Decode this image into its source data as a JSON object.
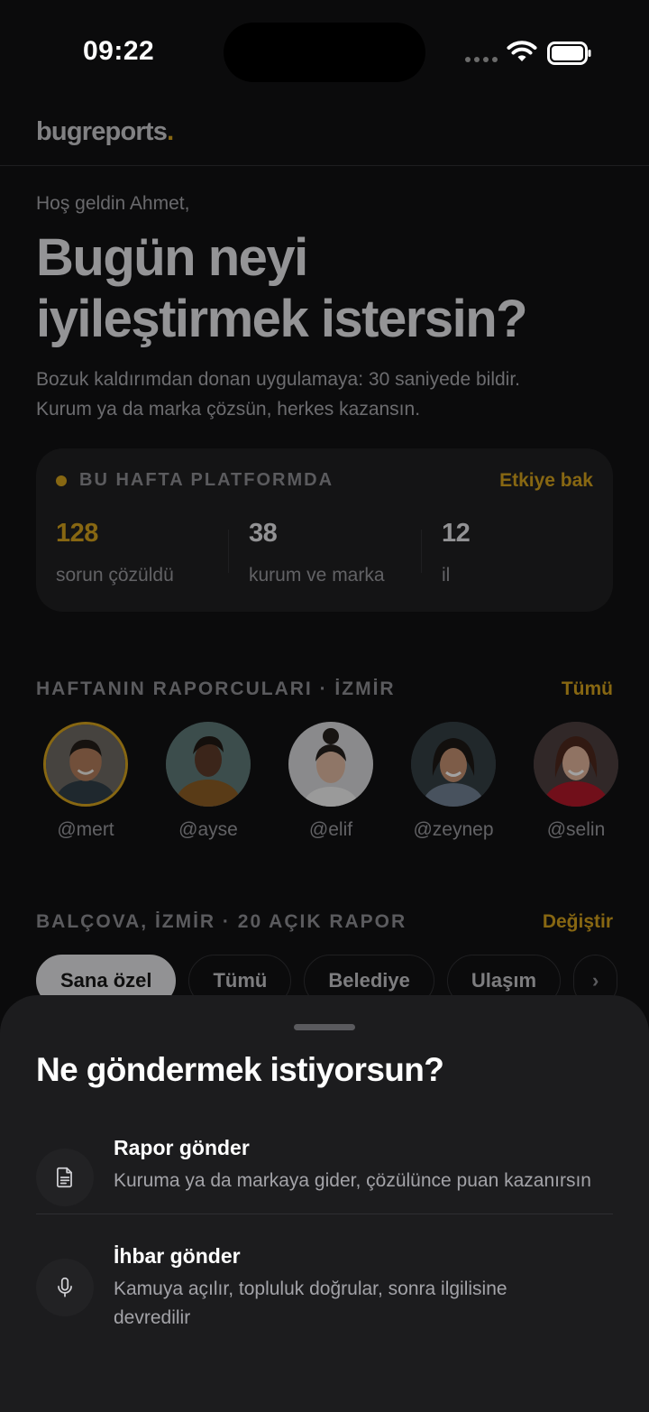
{
  "status_bar": {
    "time": "09:22"
  },
  "header": {
    "logo_text": "bugreports",
    "logo_dot": "."
  },
  "hero": {
    "greeting": "Hoş geldin Ahmet,",
    "title_line1": "Bugün neyi",
    "title_line2": "iyileştirmek istersin?",
    "subtitle_line1": "Bozuk kaldırımdan donan uygulamaya: 30 saniyede bildir.",
    "subtitle_line2": "Kurum ya da marka çözsün, herkes kazansın."
  },
  "stats": {
    "label": "BU HAFTA PLATFORMDA",
    "link": "Etkiye bak",
    "items": [
      {
        "value": "128",
        "caption": "sorun çözüldü"
      },
      {
        "value": "38",
        "caption": "kurum ve marka"
      },
      {
        "value": "12",
        "caption": "il"
      }
    ]
  },
  "reporters": {
    "title": "HAFTANIN RAPORCULARI · İZMİR",
    "link": "Tümü",
    "items": [
      {
        "handle": "@mert"
      },
      {
        "handle": "@ayse"
      },
      {
        "handle": "@elif"
      },
      {
        "handle": "@zeynep"
      },
      {
        "handle": "@selin"
      }
    ]
  },
  "location": {
    "title": "BALÇOVA, İZMİR · 20 AÇIK RAPOR",
    "link": "Değiştir",
    "chips": [
      "Sana özel",
      "Tümü",
      "Belediye",
      "Ulaşım"
    ],
    "more_glyph": "›"
  },
  "sheet": {
    "title": "Ne göndermek istiyorsun?",
    "options": [
      {
        "title": "Rapor gönder",
        "description": "Kuruma ya da markaya gider, çözülünce puan kazanırsın",
        "icon": "document-icon"
      },
      {
        "title": "İhbar gönder",
        "description": "Kamuya açılır, topluluk doğrular, sonra ilgilisine devredilir",
        "icon": "microphone-icon"
      }
    ]
  },
  "colors": {
    "accent": "#d4a017",
    "background": "#0b0b0c",
    "sheet": "#1c1c1e"
  }
}
